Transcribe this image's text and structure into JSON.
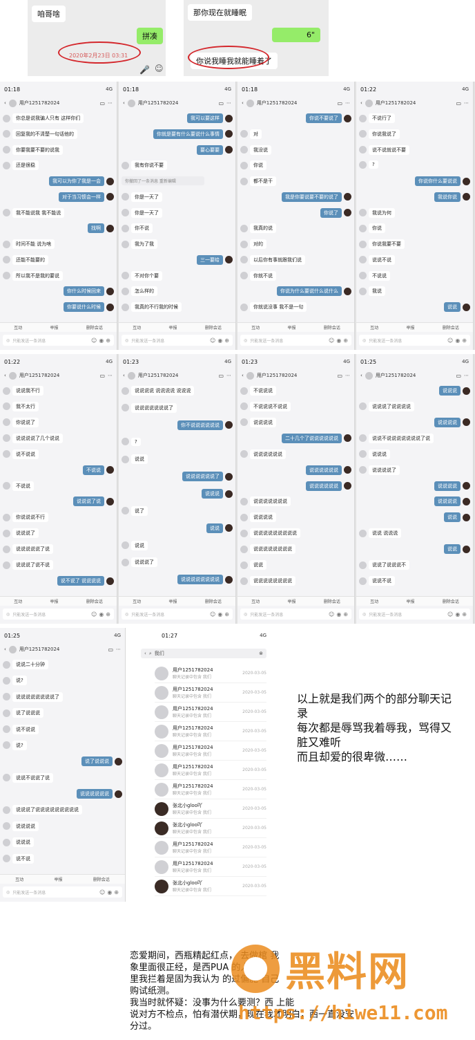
{
  "top_left": {
    "snippet": "咱哥啥",
    "reply": "拼凑",
    "timestamp": "2020年2月23日 03:31"
  },
  "top_right": {
    "incoming": "那你现在就睡眠",
    "voice": "6\"",
    "circled": "你说我睡我就能睡着了"
  },
  "row1": [
    {
      "time": "01:18",
      "network": "4G",
      "contact": "用户1251782024",
      "messages": [
        {
          "dir": "in",
          "text": "你总是说我骗人只有 这样你们"
        },
        {
          "dir": "in",
          "text": "回复我的不清楚一句话他的"
        },
        {
          "dir": "in",
          "text": "你要我要不要的说我"
        },
        {
          "dir": "in",
          "text": "还是很稳"
        },
        {
          "dir": "out",
          "text": "我可以为你了我是一会"
        },
        {
          "dir": "out",
          "text": "对于当习惯会一样"
        },
        {
          "dir": "in",
          "text": "我不能说我 我不能说"
        },
        {
          "dir": "out",
          "text": "找啊"
        },
        {
          "dir": "in",
          "text": "时间不能 说为啥"
        },
        {
          "dir": "in",
          "text": "还能不能要的"
        },
        {
          "dir": "in",
          "text": "所以我不是我的要说"
        },
        {
          "dir": "out",
          "text": "你什么时候回来"
        },
        {
          "dir": "out",
          "text": "你要说什么时候"
        }
      ]
    },
    {
      "time": "01:18",
      "network": "4G",
      "contact": "用户1251782024",
      "messages": [
        {
          "dir": "out",
          "text": "我可以要这样"
        },
        {
          "dir": "out",
          "text": "你就是要有什么要说什么事情"
        },
        {
          "dir": "out",
          "text": "要心要要"
        },
        {
          "dir": "in",
          "text": "我有你说不要"
        },
        {
          "dir": "sys",
          "text": "你撤回了一条消息 重新编辑"
        },
        {
          "dir": "in",
          "text": "你是一天了"
        },
        {
          "dir": "in",
          "text": "你是一天了"
        },
        {
          "dir": "in",
          "text": "你不说"
        },
        {
          "dir": "in",
          "text": "我为了我"
        },
        {
          "dir": "out",
          "text": "三一要给"
        },
        {
          "dir": "in",
          "text": "不对你个要"
        },
        {
          "dir": "in",
          "text": "怎么样的"
        },
        {
          "dir": "in",
          "text": "我真的不行我的时候"
        }
      ]
    },
    {
      "time": "01:18",
      "network": "4G",
      "contact": "用户1251782024",
      "messages": [
        {
          "dir": "out",
          "text": "你说不要说了"
        },
        {
          "dir": "in",
          "text": "对"
        },
        {
          "dir": "in",
          "text": "我没说"
        },
        {
          "dir": "in",
          "text": "你说"
        },
        {
          "dir": "in",
          "text": "都不是干"
        },
        {
          "dir": "out",
          "text": "我是你要说要不要的说了"
        },
        {
          "dir": "out",
          "text": "你说了"
        },
        {
          "dir": "in",
          "text": "我真的说"
        },
        {
          "dir": "in",
          "text": "对的"
        },
        {
          "dir": "in",
          "text": "以后你有事就跟我们说"
        },
        {
          "dir": "in",
          "text": "你就不说"
        },
        {
          "dir": "out",
          "text": "你说为什么要说什么说什么"
        },
        {
          "dir": "in",
          "text": "你就说没事 我不是一句"
        }
      ]
    },
    {
      "time": "01:22",
      "network": "4G",
      "contact": "用户1251782024",
      "messages": [
        {
          "dir": "in",
          "text": "不说行了"
        },
        {
          "dir": "in",
          "text": "你说我说了"
        },
        {
          "dir": "in",
          "text": "说不说就说不要"
        },
        {
          "dir": "in",
          "text": "?"
        },
        {
          "dir": "out",
          "text": "你说你什么要说说"
        },
        {
          "dir": "out",
          "text": "我说你说"
        },
        {
          "dir": "in",
          "text": "我说为何"
        },
        {
          "dir": "in",
          "text": "你说"
        },
        {
          "dir": "in",
          "text": "你说我要不要"
        },
        {
          "dir": "in",
          "text": "说说不说"
        },
        {
          "dir": "in",
          "text": "不说说"
        },
        {
          "dir": "in",
          "text": "我说"
        },
        {
          "dir": "out",
          "text": "说说"
        }
      ]
    }
  ],
  "row2": [
    {
      "time": "01:22",
      "network": "4G",
      "contact": "用户1251782024",
      "messages": [
        {
          "dir": "in",
          "text": "说说我不行"
        },
        {
          "dir": "in",
          "text": "我不太行"
        },
        {
          "dir": "in",
          "text": "你说说了"
        },
        {
          "dir": "in",
          "text": "说说说说了几个说说"
        },
        {
          "dir": "in",
          "text": "说不说说"
        },
        {
          "dir": "out",
          "text": "不说说"
        },
        {
          "dir": "in",
          "text": "不说说"
        },
        {
          "dir": "out",
          "text": "说说说了说"
        },
        {
          "dir": "in",
          "text": "你说说说不行"
        },
        {
          "dir": "in",
          "text": "说说说了"
        },
        {
          "dir": "in",
          "text": "说说说说说了说"
        },
        {
          "dir": "in",
          "text": "说说说了说不说"
        },
        {
          "dir": "out",
          "text": "说不说了 说说说说"
        }
      ]
    },
    {
      "time": "01:23",
      "network": "4G",
      "contact": "用户1251782024",
      "messages": [
        {
          "dir": "in",
          "text": "说说说说 说说说说 说说说"
        },
        {
          "dir": "in",
          "text": "说说说说说说说了"
        },
        {
          "dir": "out",
          "text": "你不说说说说说说"
        },
        {
          "dir": "in",
          "text": "?"
        },
        {
          "dir": "in",
          "text": "说说"
        },
        {
          "dir": "out",
          "text": "说说说说说说了"
        },
        {
          "dir": "out",
          "text": "说说说"
        },
        {
          "dir": "in",
          "text": "说了"
        },
        {
          "dir": "out",
          "text": "说说"
        },
        {
          "dir": "in",
          "text": "说说"
        },
        {
          "dir": "in",
          "text": "说说说了"
        },
        {
          "dir": "out",
          "text": "说说说说说说说说"
        }
      ]
    },
    {
      "time": "01:23",
      "network": "4G",
      "contact": "用户1251782024",
      "messages": [
        {
          "dir": "in",
          "text": "不说说说"
        },
        {
          "dir": "in",
          "text": "不说说说不说说"
        },
        {
          "dir": "in",
          "text": "说说说说"
        },
        {
          "dir": "out",
          "text": "二十几个了说说说说说说"
        },
        {
          "dir": "in",
          "text": "说说说说说说"
        },
        {
          "dir": "out",
          "text": "说说说说说说"
        },
        {
          "dir": "out",
          "text": "说说说说说说"
        },
        {
          "dir": "in",
          "text": "说说说说说说说"
        },
        {
          "dir": "in",
          "text": "说说说说"
        },
        {
          "dir": "in",
          "text": "说说说说说说说说说"
        },
        {
          "dir": "in",
          "text": "说说说说说说说说"
        },
        {
          "dir": "in",
          "text": "说说"
        },
        {
          "dir": "in",
          "text": "说说说说说说说说"
        }
      ]
    },
    {
      "time": "01:25",
      "network": "4G",
      "contact": "用户1251782024",
      "messages": [
        {
          "dir": "out",
          "text": "说说说"
        },
        {
          "dir": "in",
          "text": "说说说了说说说说"
        },
        {
          "dir": "out",
          "text": "说说说说"
        },
        {
          "dir": "in",
          "text": "说说不说说说说说说说了说"
        },
        {
          "dir": "in",
          "text": "说说说"
        },
        {
          "dir": "in",
          "text": "说说说说了"
        },
        {
          "dir": "out",
          "text": "说说说说"
        },
        {
          "dir": "out",
          "text": "说说说说"
        },
        {
          "dir": "out",
          "text": "说说"
        },
        {
          "dir": "in",
          "text": "说说 说说说"
        },
        {
          "dir": "out",
          "text": "说说"
        },
        {
          "dir": "in",
          "text": "说说了说说说不"
        },
        {
          "dir": "in",
          "text": "说说不说"
        }
      ]
    }
  ],
  "row3_chat": {
    "time": "01:25",
    "network": "4G",
    "contact": "用户1251782024",
    "messages": [
      {
        "dir": "in",
        "text": "说说二十分钟"
      },
      {
        "dir": "in",
        "text": "说?"
      },
      {
        "dir": "in",
        "text": "说说说说说说说说了"
      },
      {
        "dir": "in",
        "text": "说了说说说"
      },
      {
        "dir": "in",
        "text": "说不说说"
      },
      {
        "dir": "in",
        "text": "说?"
      },
      {
        "dir": "out",
        "text": "说了说说说"
      },
      {
        "dir": "in",
        "text": "说说不说说了说"
      },
      {
        "dir": "out",
        "text": "说说说说说说"
      },
      {
        "dir": "in",
        "text": "说说说了说说说说说说说说说"
      },
      {
        "dir": "in",
        "text": "说说说说"
      },
      {
        "dir": "in",
        "text": "说说说"
      },
      {
        "dir": "in",
        "text": "说不说"
      }
    ]
  },
  "toolbar": {
    "a": "互动",
    "b": "举报",
    "c": "删除会话"
  },
  "input_placeholder": "只能发送一条消息",
  "search_screen": {
    "time": "01:27",
    "network": "4G",
    "query": "我们",
    "results": [
      {
        "name": "用户1251782024",
        "preview": "聊天记录中包含 我们",
        "date": "2020-03-05",
        "dark": false
      },
      {
        "name": "用户1251782024",
        "preview": "聊天记录中包含 我们",
        "date": "2020-03-05",
        "dark": false
      },
      {
        "name": "用户1251782024",
        "preview": "聊天记录中包含 我们",
        "date": "2020-03-05",
        "dark": false
      },
      {
        "name": "用户1251782024",
        "preview": "聊天记录中包含 我们",
        "date": "2020-03-05",
        "dark": false
      },
      {
        "name": "用户1251782024",
        "preview": "聊天记录中包含 我们",
        "date": "2020-03-05",
        "dark": false
      },
      {
        "name": "用户1251782024",
        "preview": "聊天记录中包含 我们",
        "date": "2020-03-05",
        "dark": false
      },
      {
        "name": "用户1251782024",
        "preview": "聊天记录中包含 我们",
        "date": "2020-03-05",
        "dark": false
      },
      {
        "name": "张北小gloo吖",
        "preview": "聊天记录中包含 我们",
        "date": "2020-03-05",
        "dark": true
      },
      {
        "name": "张北小gloo吖",
        "preview": "聊天记录中包含 我们",
        "date": "2020-03-05",
        "dark": true
      },
      {
        "name": "用户1251782024",
        "preview": "聊天记录中包含 我们",
        "date": "2020-03-05",
        "dark": false
      },
      {
        "name": "用户1251782024",
        "preview": "聊天记录中包含 我们",
        "date": "2020-03-05",
        "dark": false
      },
      {
        "name": "张北小gloo吖",
        "preview": "聊天记录中包含 我们",
        "date": "2020-03-05",
        "dark": true
      }
    ]
  },
  "note": {
    "line1": "以上就是我们两个的部分聊天记",
    "line2": "录",
    "line3": "每次都是辱骂我着辱我，骂得又",
    "line4": "脏又难听",
    "line5": "而且却爱的很卑微……"
  },
  "bottom": {
    "l1": "恋爱期间，西瓶精起红点，   去做棺     我",
    "l2": "象里面很正经，是西PUA         的人设。",
    "l3": "里我拦着是固为我认为        的过偏施    自己",
    "l4": "购试纸测。",
    "l5": "我当时就怀疑：没事为什么要测？西       上能",
    "l6": "说对方不检点，怕有潜伏期，现在我才明白，西一直没安",
    "l7": "分过。"
  },
  "watermark": {
    "big": "黑料网",
    "url": "https://hiwe11.com"
  },
  "colors": {
    "accent_bubble": "#5b8fb9",
    "circle": "#d4262b",
    "watermark": "#eb8c1e",
    "wechat_green": "#95ec69"
  }
}
